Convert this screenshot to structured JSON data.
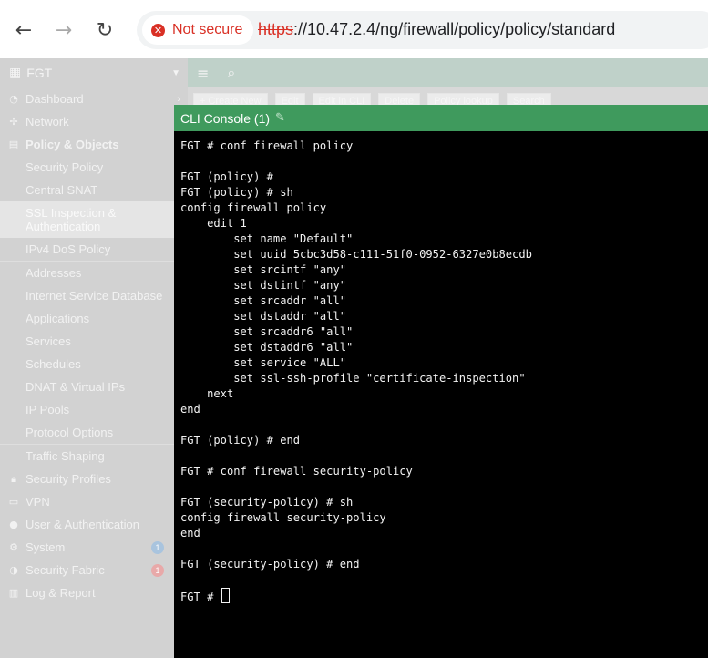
{
  "browser": {
    "back_glyph": "←",
    "forward_glyph": "→",
    "reload_glyph": "↻",
    "security_icon_glyph": "✕",
    "security_label": "Not secure",
    "url_scheme": "https",
    "url_rest": "://10.47.2.4/ng/firewall/policy/policy/standard",
    "colors": {
      "warning": "#d93025"
    }
  },
  "sidebar": {
    "device": "FGT",
    "items": [
      {
        "label": "Dashboard",
        "icon": "dashboard-icon"
      },
      {
        "label": "Network",
        "icon": "network-icon"
      },
      {
        "label": "Policy & Objects",
        "icon": "policy-icon"
      },
      {
        "label": "Security Policy"
      },
      {
        "label": "Central SNAT"
      },
      {
        "label": "SSL Inspection & Authentication"
      },
      {
        "label": "IPv4 DoS Policy"
      },
      {
        "label": "Addresses"
      },
      {
        "label": "Internet Service Database"
      },
      {
        "label": "Applications"
      },
      {
        "label": "Services"
      },
      {
        "label": "Schedules"
      },
      {
        "label": "DNAT & Virtual IPs"
      },
      {
        "label": "IP Pools"
      },
      {
        "label": "Protocol Options"
      },
      {
        "label": "Traffic Shaping"
      },
      {
        "label": "Security Profiles",
        "icon": "lock-icon"
      },
      {
        "label": "VPN",
        "icon": "vpn-icon"
      },
      {
        "label": "User & Authentication",
        "icon": "user-icon"
      },
      {
        "label": "System",
        "icon": "gear-icon",
        "badge": "1"
      },
      {
        "label": "Security Fabric",
        "icon": "fabric-icon",
        "badge": "1"
      },
      {
        "label": "Log & Report",
        "icon": "log-icon"
      }
    ]
  },
  "toolbar": {
    "create": "+ Create New",
    "edit": "Edit",
    "edit_cli": "Edit in CLI",
    "delete": "Delete",
    "lookup": "Policy lookup",
    "search": "Search"
  },
  "cli": {
    "title": "CLI Console (1)",
    "lines": [
      "FGT # conf firewall policy",
      "",
      "FGT (policy) #",
      "FGT (policy) # sh",
      "config firewall policy",
      "    edit 1",
      "        set name \"Default\"",
      "        set uuid 5cbc3d58-c111-51f0-0952-6327e0b8ecdb",
      "        set srcintf \"any\"",
      "        set dstintf \"any\"",
      "        set srcaddr \"all\"",
      "        set dstaddr \"all\"",
      "        set srcaddr6 \"all\"",
      "        set dstaddr6 \"all\"",
      "        set service \"ALL\"",
      "        set ssl-ssh-profile \"certificate-inspection\"",
      "    next",
      "end",
      "",
      "FGT (policy) # end",
      "",
      "FGT # conf firewall security-policy",
      "",
      "FGT (security-policy) # sh",
      "config firewall security-policy",
      "end",
      "",
      "FGT (security-policy) # end",
      ""
    ],
    "prompt": "FGT # ",
    "colors": {
      "header": "#3f9a5d",
      "background": "#000000",
      "text": "#f2f2f2"
    }
  }
}
